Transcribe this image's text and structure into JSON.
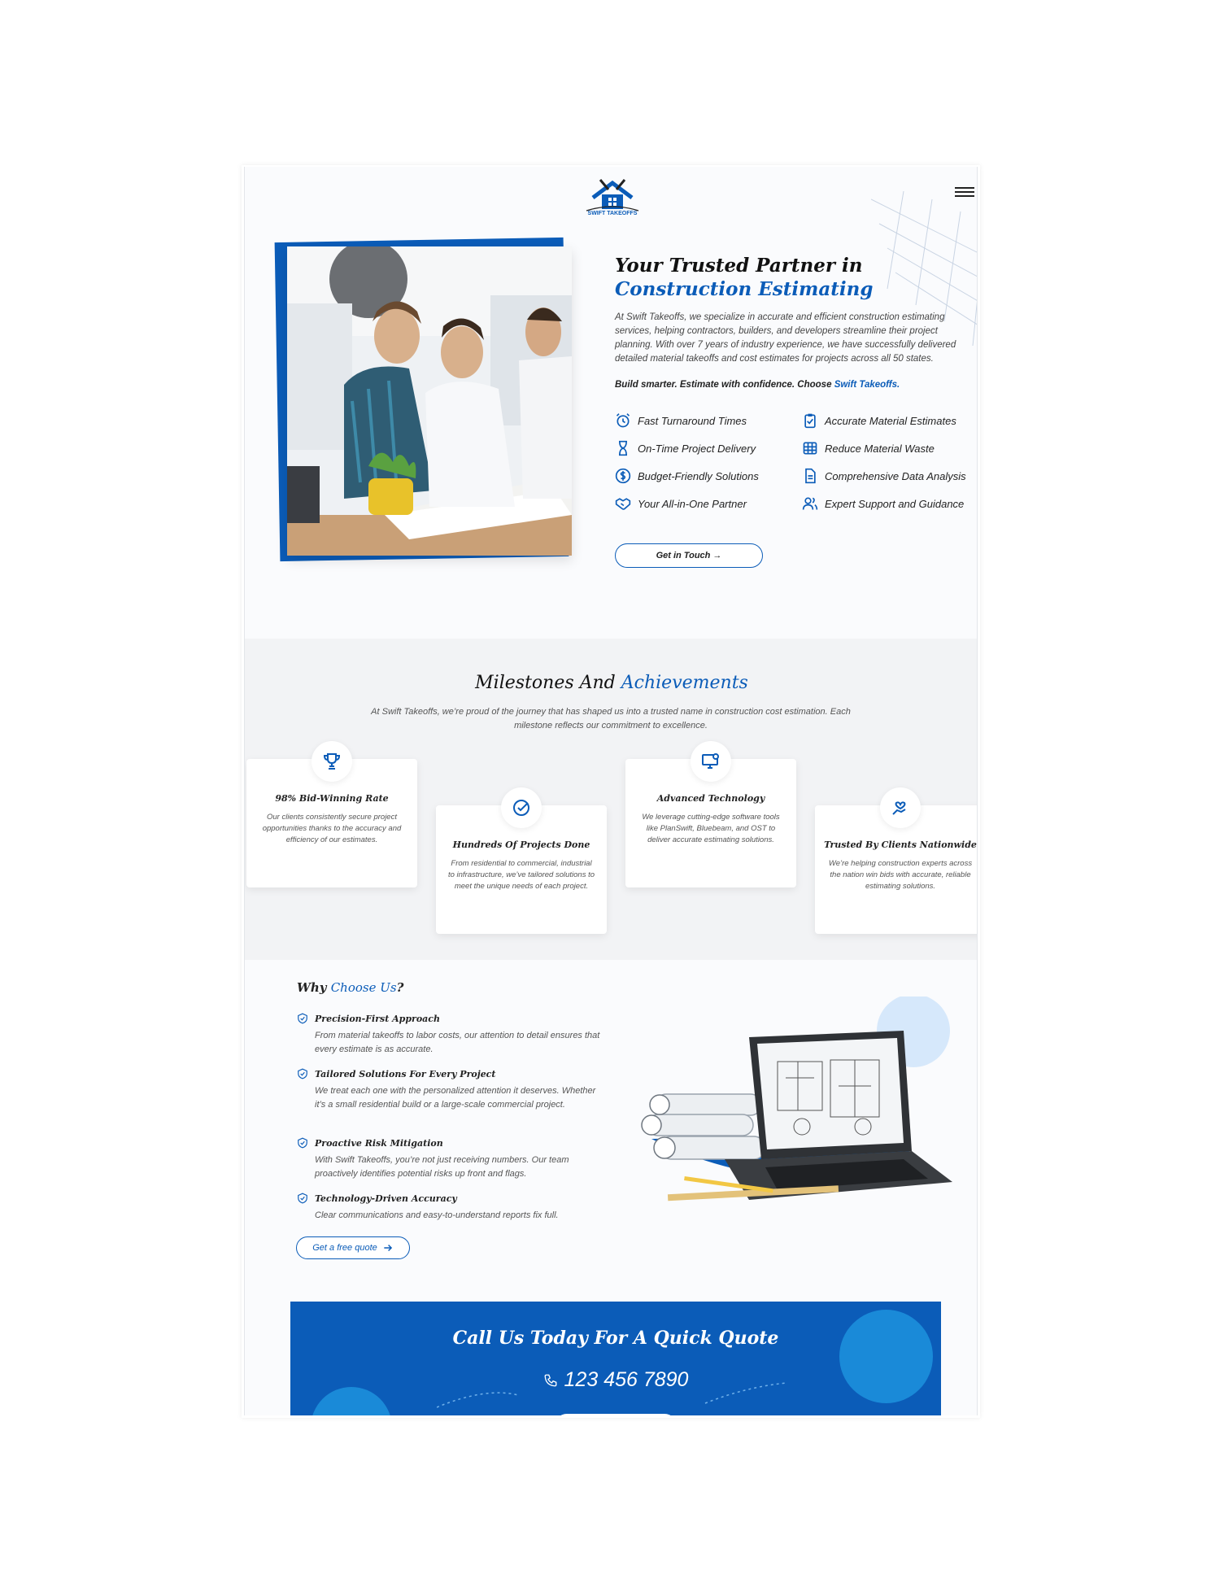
{
  "brand": {
    "name": "SWIFT TAKEOFFS"
  },
  "hero": {
    "title_line1": "Your Trusted Partner in",
    "title_line2": "Construction Estimating",
    "paragraph": "At Swift Takeoffs, we specialize in accurate and efficient construction estimating services, helping contractors, builders, and developers streamline their project planning. With over 7 years of industry experience, we have successfully delivered detailed material takeoffs and cost estimates for projects across all 50 states.",
    "tagline": "Build smarter. Estimate with confidence. Choose",
    "tagline_brand": "Swift Takeoffs.",
    "features": [
      {
        "label": "Fast Turnaround Times",
        "icon": "alarm-clock-icon"
      },
      {
        "label": "Accurate Material Estimates",
        "icon": "clipboard-check-icon"
      },
      {
        "label": "On-Time Project Delivery",
        "icon": "hourglass-icon"
      },
      {
        "label": "Reduce Material Waste",
        "icon": "grid-icon"
      },
      {
        "label": "Budget-Friendly Solutions",
        "icon": "dollar-circle-icon"
      },
      {
        "label": "Comprehensive Data Analysis",
        "icon": "document-icon"
      },
      {
        "label": "Your All-in-One Partner",
        "icon": "handshake-icon"
      },
      {
        "label": "Expert Support and Guidance",
        "icon": "users-icon"
      }
    ],
    "cta_label": "Get in Touch →"
  },
  "milestones": {
    "title": "Milestones And",
    "title_accent": "Achievements",
    "subtitle": "At Swift Takeoffs, we’re proud of the journey that has shaped us into a trusted name in construction cost estimation. Each milestone reflects our commitment to excellence.",
    "cards": [
      {
        "title": "98% Bid-Winning Rate",
        "text": "Our clients consistently secure project opportunities thanks to the accuracy and efficiency of our estimates.",
        "icon": "trophy-icon"
      },
      {
        "title": "Hundreds Of Projects Done",
        "text": "From residential to commercial, industrial to infrastructure, we’ve tailored solutions to meet the unique needs of each project.",
        "icon": "check-circle-icon"
      },
      {
        "title": "Advanced Technology",
        "text": "We leverage cutting-edge software tools like PlanSwift, Bluebeam, and OST to deliver accurate estimating solutions.",
        "icon": "monitor-gear-icon"
      },
      {
        "title": "Trusted By Clients Nationwide",
        "text": "We’re helping construction experts across the nation win bids with accurate, reliable estimating solutions.",
        "icon": "hand-heart-icon"
      }
    ]
  },
  "why": {
    "title": "Why",
    "title_accent": "Choose Us",
    "title_end": "?",
    "items": [
      {
        "title": "Precision-First Approach",
        "text": "From material takeoffs to labor costs, our attention to detail ensures that every estimate is as accurate."
      },
      {
        "title": "Tailored Solutions For Every Project",
        "text": "We treat each one with the personalized attention it deserves. Whether it’s a small residential build or a large-scale commercial project."
      },
      {
        "title": "Proactive Risk Mitigation",
        "text": "With Swift Takeoffs, you’re not just receiving numbers. Our team proactively identifies potential risks up front and flags."
      },
      {
        "title": "Technology-Driven Accuracy",
        "text": "Clear communications and easy-to-understand reports fix full."
      }
    ],
    "cta_label": "Get a free quote"
  },
  "cta": {
    "title": "Call Us Today For A Quick Quote",
    "phone": "123 456 7890"
  },
  "colors": {
    "accent": "#0b5cb8",
    "accent_light": "#1a8ad8",
    "section_bg": "#f2f3f5"
  }
}
